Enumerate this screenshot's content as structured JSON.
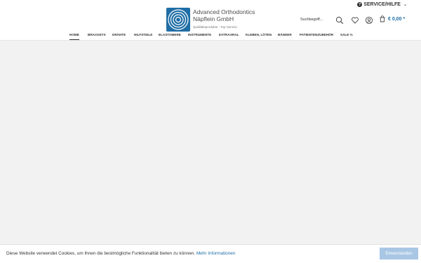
{
  "header": {
    "service_label": "SERVICE/HILFE",
    "brand_line1": "Advanced Orthodontics",
    "brand_line2": "Näpflein GmbH",
    "brand_tagline": "Qualitätsprodukte · Top Service",
    "search_placeholder": "Suchbegriff...",
    "cart_amount": "€ 0,00 *"
  },
  "nav": {
    "items": [
      {
        "label": "HOME",
        "active": true
      },
      {
        "label": "BRACKETS"
      },
      {
        "label": "DRÄHTE"
      },
      {
        "label": "HILFSTEILE"
      },
      {
        "label": "ELASTOMERE"
      },
      {
        "label": "INSTRUMENTE"
      },
      {
        "label": "EXTRAORAL"
      },
      {
        "label": "KLEBEN, LÖTEN"
      },
      {
        "label": "BÄNDER"
      },
      {
        "label": "PATIENTENZUBEHÖR"
      },
      {
        "label": "SALE %"
      }
    ]
  },
  "cookie": {
    "message": "Diese Website verwendet Cookies, um Ihnen die bestmögliche Funktionalität bieten zu können.",
    "more_link": "Mehr Informationen",
    "accept_label": "Einverstanden"
  },
  "colors": {
    "brand_blue": "#1f6ea6",
    "accept_button": "#a9c7e4",
    "page_background": "#f2f2f2"
  },
  "icons": [
    "question-icon",
    "chevron-down-icon",
    "logo-rings-icon",
    "search-icon",
    "heart-icon",
    "account-icon",
    "cart-icon"
  ]
}
